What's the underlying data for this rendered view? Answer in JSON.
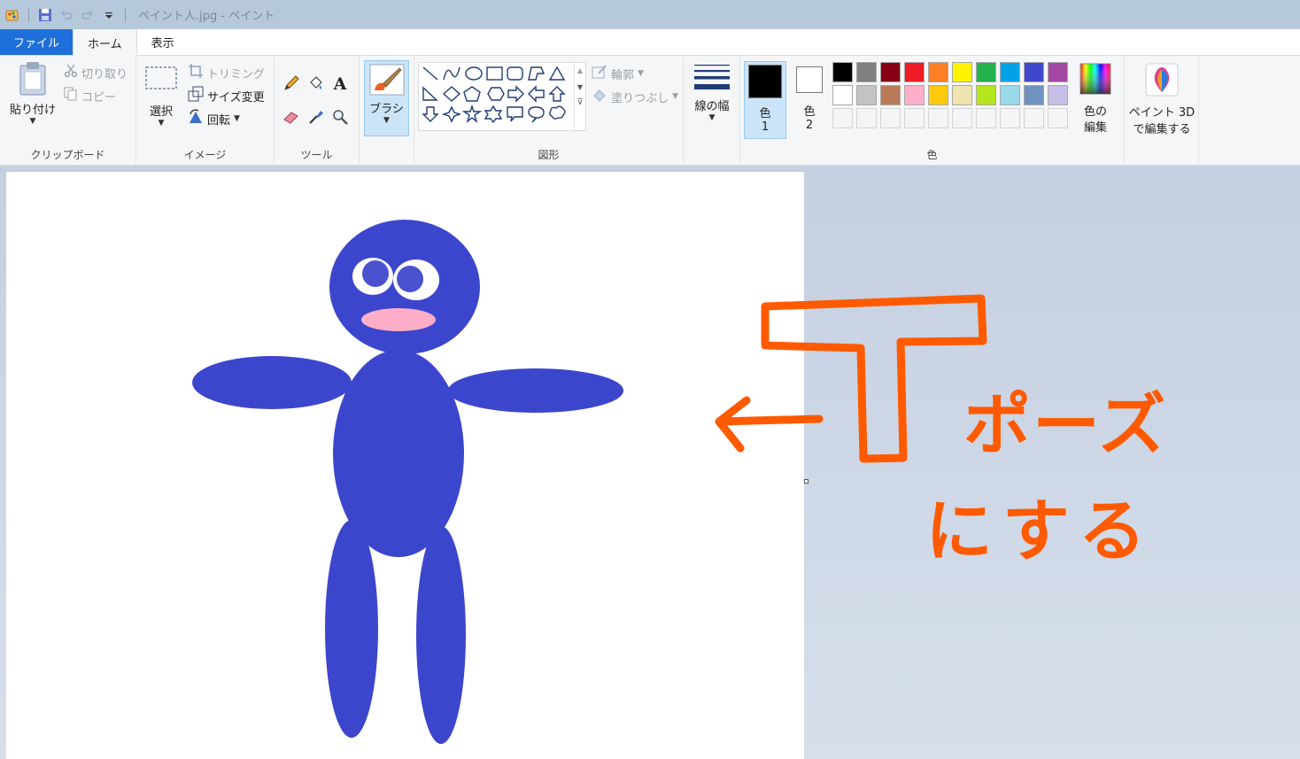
{
  "window": {
    "title": "ペイント人.jpg - ペイント"
  },
  "tabs": [
    {
      "label": "ファイル"
    },
    {
      "label": "ホーム"
    },
    {
      "label": "表示"
    }
  ],
  "clipboard": {
    "paste": "貼り付け",
    "cut": "切り取り",
    "copy": "コピー",
    "group": "クリップボード"
  },
  "image": {
    "select": "選択",
    "crop": "トリミング",
    "resize": "サイズ変更",
    "rotate": "回転",
    "group": "イメージ"
  },
  "tools": {
    "group": "ツール"
  },
  "brushes": {
    "label": "ブラシ"
  },
  "shapes": {
    "outline": "輪郭",
    "fill": "塗りつぶし",
    "group": "図形"
  },
  "line_width": {
    "label": "線の幅"
  },
  "colors": {
    "color1_label": "色",
    "color1_num": "1",
    "color2_label": "色",
    "color2_num": "2",
    "edit_line1": "色の",
    "edit_line2": "編集",
    "group": "色",
    "current1": "#000000",
    "current2": "#ffffff",
    "palette_row1": [
      "#000000",
      "#7f7f7f",
      "#880015",
      "#ed1c24",
      "#ff7f27",
      "#fff200",
      "#22b14c",
      "#00a2e8",
      "#3f48cc",
      "#a349a4"
    ],
    "palette_row2": [
      "#ffffff",
      "#c3c3c3",
      "#b97a57",
      "#ffaec9",
      "#ffc90e",
      "#efe4b0",
      "#b5e61d",
      "#99d9ea",
      "#7092be",
      "#c8bfe7"
    ]
  },
  "paint3d": {
    "line1": "ペイント 3D",
    "line2": "で編集する"
  },
  "annotation": {
    "letter": "T",
    "line1": "ポーズ",
    "line2": "にする",
    "color": "#ff5a00"
  },
  "figure": {
    "body_color": "#3c46cd",
    "mouth_color": "#ffaec9"
  }
}
